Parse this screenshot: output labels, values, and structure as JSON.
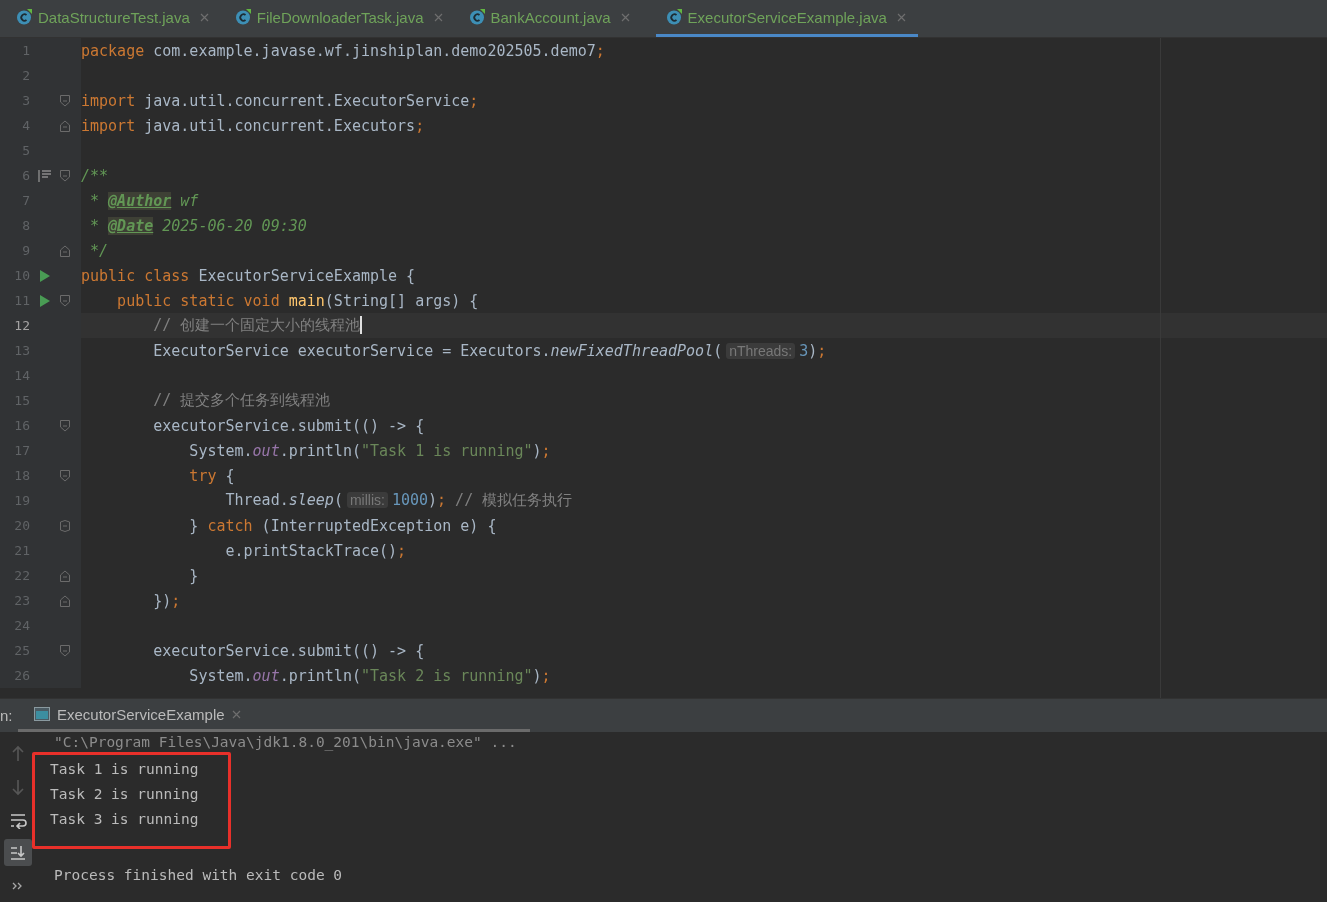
{
  "tabs": [
    {
      "label": "DataStructureTest.java",
      "selected": false
    },
    {
      "label": "FileDownloaderTask.java",
      "selected": false
    },
    {
      "label": "BankAccount.java",
      "selected": false
    },
    {
      "label": "ExecutorServiceExample.java",
      "selected": true
    }
  ],
  "editor": {
    "lines": [
      {
        "number": "1",
        "current": false,
        "tokens": [
          {
            "kind": "kw",
            "text": "package"
          },
          {
            "kind": "plain",
            "text": " com.example.javase.wf.jinshiplan.demo202505.demo7"
          },
          {
            "kind": "kw",
            "text": ";"
          }
        ]
      },
      {
        "number": "2",
        "current": false
      },
      {
        "number": "3",
        "current": false,
        "fold_open": true,
        "tokens": [
          {
            "kind": "kw",
            "text": "import"
          },
          {
            "kind": "plain",
            "text": " java.util.concurrent.ExecutorService"
          },
          {
            "kind": "kw",
            "text": ";"
          }
        ]
      },
      {
        "number": "4",
        "current": false,
        "fold_close": true,
        "tokens": [
          {
            "kind": "kw",
            "text": "import"
          },
          {
            "kind": "plain",
            "text": " java.util.concurrent.Executors"
          },
          {
            "kind": "kw",
            "text": ";"
          }
        ]
      },
      {
        "number": "5",
        "current": false
      },
      {
        "number": "6",
        "current": false,
        "doc_marker": true,
        "fold_open": true,
        "tokens": [
          {
            "kind": "doc",
            "text": "/**"
          }
        ]
      },
      {
        "number": "7",
        "current": false,
        "tokens": [
          {
            "kind": "doc",
            "text": " * "
          },
          {
            "kind": "tag",
            "text": "@Author"
          },
          {
            "kind": "doc",
            "text": " wf"
          }
        ]
      },
      {
        "number": "8",
        "current": false,
        "tokens": [
          {
            "kind": "doc",
            "text": " * "
          },
          {
            "kind": "tag",
            "text": "@Date"
          },
          {
            "kind": "doc",
            "text": " 2025-06-20 09:30"
          }
        ]
      },
      {
        "number": "9",
        "current": false,
        "fold_close": true,
        "tokens": [
          {
            "kind": "doc",
            "text": " */"
          }
        ]
      },
      {
        "number": "10",
        "current": false,
        "run": true,
        "tokens": [
          {
            "kind": "kw",
            "text": "public class "
          },
          {
            "kind": "plain",
            "text": "ExecutorServiceExample {"
          }
        ]
      },
      {
        "number": "11",
        "current": false,
        "run": true,
        "fold_open": true,
        "tokens": [
          {
            "kind": "kw",
            "text": "    public static void "
          },
          {
            "kind": "method",
            "text": "main"
          },
          {
            "kind": "plain",
            "text": "(String[] args) {"
          }
        ]
      },
      {
        "number": "12",
        "current": true,
        "tokens": [
          {
            "kind": "comment",
            "text": "        // 创建一个固定大小的线程池"
          }
        ]
      },
      {
        "number": "13",
        "current": false,
        "tokens": [
          {
            "kind": "plain",
            "text": "        ExecutorService executorService = Executors."
          },
          {
            "kind": "static",
            "text": "newFixedThreadPool"
          },
          {
            "kind": "plain",
            "text": "("
          },
          {
            "kind": "hint",
            "text": "nThreads:"
          },
          {
            "kind": "num",
            "text": "3"
          },
          {
            "kind": "plain",
            "text": ")"
          },
          {
            "kind": "kw",
            "text": ";"
          }
        ]
      },
      {
        "number": "14",
        "current": false
      },
      {
        "number": "15",
        "current": false,
        "tokens": [
          {
            "kind": "comment",
            "text": "        // 提交多个任务到线程池"
          }
        ]
      },
      {
        "number": "16",
        "current": false,
        "fold_open": true,
        "tokens": [
          {
            "kind": "plain",
            "text": "        executorService.submit(() -> {"
          }
        ]
      },
      {
        "number": "17",
        "current": false,
        "tokens": [
          {
            "kind": "plain",
            "text": "            System."
          },
          {
            "kind": "field",
            "text": "out"
          },
          {
            "kind": "plain",
            "text": ".println("
          },
          {
            "kind": "str",
            "text": "\"Task 1 is running\""
          },
          {
            "kind": "plain",
            "text": ")"
          },
          {
            "kind": "kw",
            "text": ";"
          }
        ]
      },
      {
        "number": "18",
        "current": false,
        "fold_open": true,
        "tokens": [
          {
            "kind": "kw",
            "text": "            try"
          },
          {
            "kind": "plain",
            "text": " {"
          }
        ]
      },
      {
        "number": "19",
        "current": false,
        "tokens": [
          {
            "kind": "plain",
            "text": "                Thread."
          },
          {
            "kind": "static",
            "text": "sleep"
          },
          {
            "kind": "plain",
            "text": "("
          },
          {
            "kind": "hint",
            "text": "millis:"
          },
          {
            "kind": "num",
            "text": "1000"
          },
          {
            "kind": "plain",
            "text": ")"
          },
          {
            "kind": "kw",
            "text": ";"
          },
          {
            "kind": "comment",
            "text": " // 模拟任务执行"
          }
        ]
      },
      {
        "number": "20",
        "current": false,
        "fold_open": true,
        "fold_close": true,
        "tokens": [
          {
            "kind": "plain",
            "text": "            } "
          },
          {
            "kind": "kw",
            "text": "catch"
          },
          {
            "kind": "plain",
            "text": " (InterruptedException e) {"
          }
        ]
      },
      {
        "number": "21",
        "current": false,
        "tokens": [
          {
            "kind": "plain",
            "text": "                e.printStackTrace()"
          },
          {
            "kind": "kw",
            "text": ";"
          }
        ]
      },
      {
        "number": "22",
        "current": false,
        "fold_close": true,
        "tokens": [
          {
            "kind": "plain",
            "text": "            }"
          }
        ]
      },
      {
        "number": "23",
        "current": false,
        "fold_close": true,
        "tokens": [
          {
            "kind": "plain",
            "text": "        })"
          },
          {
            "kind": "kw",
            "text": ";"
          }
        ]
      },
      {
        "number": "24",
        "current": false
      },
      {
        "number": "25",
        "current": false,
        "fold_open": true,
        "tokens": [
          {
            "kind": "plain",
            "text": "        executorService.submit(() -> {"
          }
        ]
      },
      {
        "number": "26",
        "current": false,
        "tokens": [
          {
            "kind": "plain",
            "text": "            System."
          },
          {
            "kind": "field",
            "text": "out"
          },
          {
            "kind": "plain",
            "text": ".println("
          },
          {
            "kind": "str",
            "text": "\"Task 2 is running\""
          },
          {
            "kind": "plain",
            "text": ")"
          },
          {
            "kind": "kw",
            "text": ";"
          }
        ]
      }
    ]
  },
  "run_panel": {
    "label": "n:",
    "tab": "ExecutorServiceExample",
    "tools": [
      {
        "kind": "up",
        "disabled": true,
        "selected": false
      },
      {
        "kind": "down",
        "disabled": true,
        "selected": false
      },
      {
        "kind": "wrap",
        "disabled": false,
        "selected": false
      },
      {
        "kind": "scroll-end",
        "disabled": false,
        "selected": true
      },
      {
        "kind": "more",
        "disabled": false,
        "selected": false
      }
    ],
    "command": "\"C:\\Program Files\\Java\\jdk1.8.0_201\\bin\\java.exe\" ...",
    "highlighted_output": [
      "Task 1 is running",
      "Task 2 is running",
      "Task 3 is running"
    ],
    "exit_message": "Process finished with exit code 0"
  }
}
